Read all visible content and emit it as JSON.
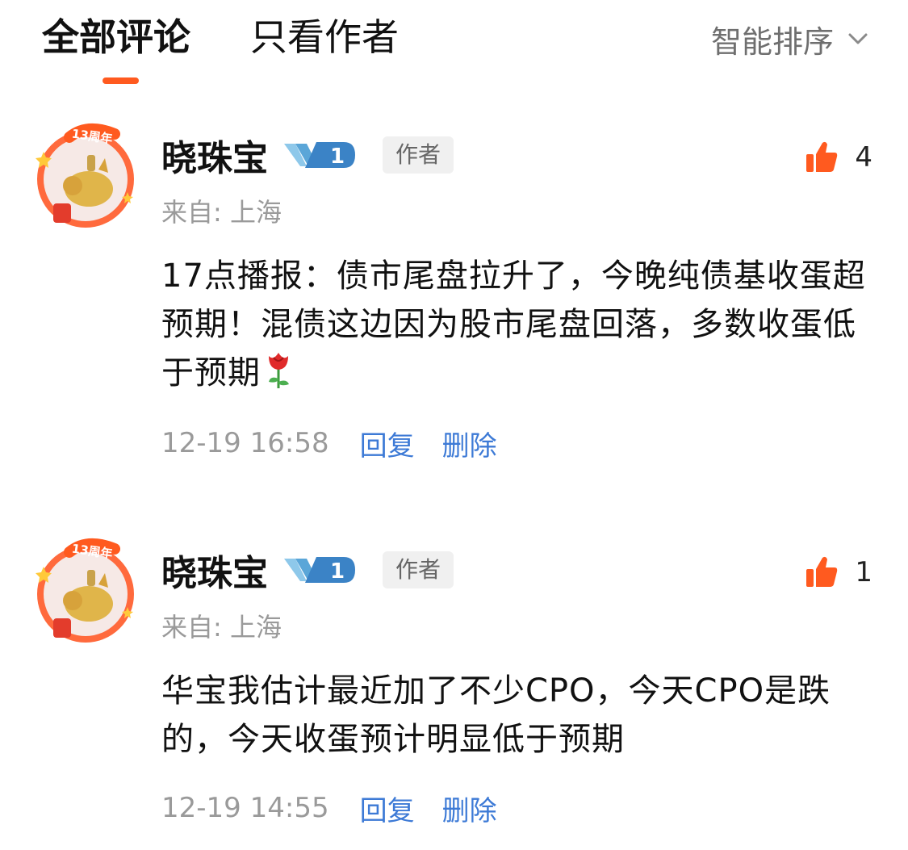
{
  "tabs": {
    "all_comments": "全部评论",
    "author_only": "只看作者"
  },
  "sort": {
    "label": "智能排序"
  },
  "colors": {
    "accent": "#ff5a1f",
    "link": "#3d7ad6",
    "muted": "#9a9a9a"
  },
  "comments": [
    {
      "avatar_badge": "13周年",
      "username": "晓珠宝",
      "vip_level": "1",
      "tag": "作者",
      "location": "来自: 上海",
      "likes": "4",
      "text": "17点播报：债市尾盘拉升了，今晚纯债基收蛋超预期！混债这边因为股市尾盘回落，多数收蛋低于预期",
      "emoji": "rose-emoji",
      "time": "12-19 16:58",
      "reply": "回复",
      "delete": "删除"
    },
    {
      "avatar_badge": "13周年",
      "username": "晓珠宝",
      "vip_level": "1",
      "tag": "作者",
      "location": "来自: 上海",
      "likes": "1",
      "text": "华宝我估计最近加了不少CPO，今天CPO是跌的，今天收蛋预计明显低于预期",
      "time": "12-19 14:55",
      "reply": "回复",
      "delete": "删除"
    }
  ]
}
